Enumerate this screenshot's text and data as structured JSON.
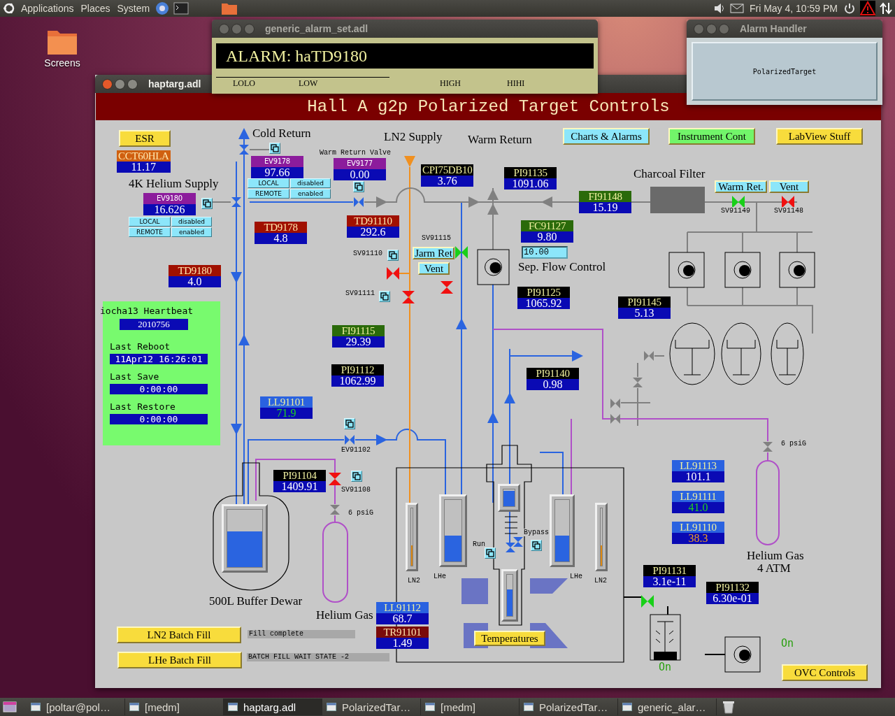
{
  "top_panel": {
    "menus": [
      "Applications",
      "Places",
      "System"
    ],
    "clock": "Fri May 4, 10:59 PM"
  },
  "desktop_icons": [
    {
      "label": "Screens"
    }
  ],
  "alarm_window": {
    "title": "generic_alarm_set.adl",
    "alarm": "ALARM: haTD9180",
    "limits": [
      "LOLO",
      "LOW",
      "HIGH",
      "HIHI"
    ]
  },
  "alarm_handler": {
    "title": "Alarm Handler",
    "groups": [
      "PolarizedTarget"
    ]
  },
  "main": {
    "title": "haptarg.adl",
    "header": "Hall A g2p Polarized Target Controls",
    "buttons": [
      {
        "label": "ESR",
        "color": "#f8dc3c"
      },
      {
        "label": "Charts & Alarms",
        "color": "#8ce6fa"
      },
      {
        "label": "Instrument Cont",
        "color": "#72f56a"
      },
      {
        "label": "LabView Stuff",
        "color": "#f8dc3c"
      },
      {
        "label": "Warm Ret.",
        "color": "#8ce6fa"
      },
      {
        "label": "Vent",
        "color": "#8ce6fa"
      },
      {
        "label": "Jarm Ret",
        "color": "#8ce6fa"
      },
      {
        "label": "Vent",
        "color": "#8ce6fa"
      },
      {
        "label": "Temperatures",
        "color": "#f8dc3c"
      },
      {
        "label": "LN2 Batch Fill",
        "color": "#f8dc3c"
      },
      {
        "label": "LHe Batch Fill",
        "color": "#f8dc3c"
      },
      {
        "label": "OVC Controls",
        "color": "#f8dc3c"
      }
    ],
    "mode_panels": [
      {
        "buttons": [
          "LOCAL",
          "disabled",
          "REMOTE",
          "enabled"
        ]
      },
      {
        "buttons": [
          "LOCAL",
          "disabled",
          "REMOTE",
          "enabled"
        ]
      }
    ],
    "readouts": [
      {
        "label": "CCT60HLA",
        "value": "11.17",
        "kind": "cct",
        "monitored": false,
        "alarm": false
      },
      {
        "label": "EV9178",
        "value": "97.66",
        "kind": "valve",
        "monitored": false,
        "alarm": false
      },
      {
        "label": "EV9177",
        "value": "0.00",
        "kind": "valve",
        "monitored": false,
        "alarm": false
      },
      {
        "label": "CPI75DB10",
        "value": "3.76",
        "kind": "pressure",
        "monitored": false,
        "alarm": false
      },
      {
        "label": "EV9180",
        "value": "16.626",
        "kind": "valve",
        "monitored": false,
        "alarm": false
      },
      {
        "label": "TD9178",
        "value": "4.8",
        "kind": "temperature",
        "monitored": false,
        "alarm": false
      },
      {
        "label": "TD91110",
        "value": "292.6",
        "kind": "temperature",
        "monitored": false,
        "alarm": false
      },
      {
        "label": "TD9180",
        "value": "4.0",
        "kind": "temperature",
        "monitored": false,
        "alarm": false
      },
      {
        "label": "PI91135",
        "value": "1091.06",
        "kind": "pressure",
        "monitored": false,
        "alarm": false
      },
      {
        "label": "FI91148",
        "value": "15.19",
        "kind": "flow",
        "monitored": false,
        "alarm": false
      },
      {
        "label": "FC91127",
        "value": "9.80",
        "kind": "flow",
        "monitored": false,
        "alarm": false
      },
      {
        "label": "PI91125",
        "value": "1065.92",
        "kind": "pressure",
        "monitored": false,
        "alarm": false
      },
      {
        "label": "PI91145",
        "value": "5.13",
        "kind": "pressure",
        "monitored": false,
        "alarm": false
      },
      {
        "label": "FI91115",
        "value": "29.39",
        "kind": "flow",
        "monitored": false,
        "alarm": false
      },
      {
        "label": "PI91112",
        "value": "1062.99",
        "kind": "pressure",
        "monitored": false,
        "alarm": false
      },
      {
        "label": "LL91101",
        "value": "71.9",
        "kind": "level",
        "monitored": true,
        "alarm": false
      },
      {
        "label": "PI91140",
        "value": "0.98",
        "kind": "pressure",
        "monitored": false,
        "alarm": false
      },
      {
        "label": "PI91104",
        "value": "1409.91",
        "kind": "pressure",
        "monitored": false,
        "alarm": false
      },
      {
        "label": "LL91113",
        "value": "101.1",
        "kind": "level",
        "monitored": false,
        "alarm": false
      },
      {
        "label": "LL91111",
        "value": "41.0",
        "kind": "level",
        "monitored": true,
        "alarm": false
      },
      {
        "label": "LL91110",
        "value": "38.3",
        "kind": "level",
        "monitored": true,
        "alarm": true
      },
      {
        "label": "LL91112",
        "value": "68.7",
        "kind": "level",
        "monitored": false,
        "alarm": false
      },
      {
        "label": "TR91101",
        "value": "1.49",
        "kind": "resistance",
        "monitored": false,
        "alarm": false
      },
      {
        "label": "PI91131",
        "value": "3.1e-11",
        "kind": "pressure",
        "monitored": false,
        "alarm": false
      },
      {
        "label": "PI91132",
        "value": "6.30e-01",
        "kind": "pressure",
        "monitored": false,
        "alarm": false
      }
    ],
    "labels": [
      {
        "text": "Cold Return",
        "kind": "title"
      },
      {
        "text": "LN2 Supply",
        "kind": "title"
      },
      {
        "text": "Warm Return",
        "kind": "title"
      },
      {
        "text": "4K Helium Supply",
        "kind": "title"
      },
      {
        "text": "Charcoal Filter",
        "kind": "title"
      },
      {
        "text": "Sep. Flow Control",
        "kind": "title"
      },
      {
        "text": "500L Buffer Dewar",
        "kind": "title"
      },
      {
        "text": "Helium Gas",
        "kind": "title"
      },
      {
        "text": "Helium Gas",
        "kind": "title"
      },
      {
        "text": "4 ATM",
        "kind": "title"
      },
      {
        "text": "Warm Return Valve",
        "kind": "small"
      },
      {
        "text": "SV91115",
        "kind": "small"
      },
      {
        "text": "SV91110",
        "kind": "small"
      },
      {
        "text": "SV91111",
        "kind": "small"
      },
      {
        "text": "SV91149",
        "kind": "small"
      },
      {
        "text": "SV91148",
        "kind": "small"
      },
      {
        "text": "EV91102",
        "kind": "small"
      },
      {
        "text": "SV91108",
        "kind": "small"
      },
      {
        "text": "6 psiG",
        "kind": "small"
      },
      {
        "text": "6 psiG",
        "kind": "small"
      },
      {
        "text": "Run",
        "kind": "small"
      },
      {
        "text": "Bypass",
        "kind": "small"
      },
      {
        "text": "LN2",
        "kind": "small"
      },
      {
        "text": "LHe",
        "kind": "small"
      },
      {
        "text": "LHe",
        "kind": "small"
      },
      {
        "text": "LN2",
        "kind": "small"
      },
      {
        "text": "On",
        "kind": "status"
      },
      {
        "text": "On",
        "kind": "status"
      }
    ],
    "valves": [
      {
        "open": true
      },
      {
        "open": false
      },
      {
        "open": false
      },
      {
        "open": false
      },
      {
        "open": true
      },
      {
        "open": false
      },
      {
        "open": false
      },
      {
        "open": true
      }
    ],
    "setpoint": {
      "value": "10.00"
    },
    "fill_status": [
      "Fill complete",
      "BATCH FILL WAIT STATE -2"
    ],
    "heartbeat": {
      "title": "iocha13 Heartbeat",
      "counter": "2010756",
      "rows": [
        {
          "label": "Last Reboot",
          "value": "11Apr12 16:26:01"
        },
        {
          "label": "Last Save",
          "value": "0:00:00"
        },
        {
          "label": "Last Restore",
          "value": "0:00:00"
        }
      ]
    },
    "gauges": [
      {
        "level": 0.62
      },
      {
        "level": 0.35
      },
      {
        "level": 0.42
      },
      {
        "level": 0.9
      },
      {
        "level": 0.65
      },
      {
        "level": 0.42
      },
      {
        "level": 0.35
      }
    ]
  },
  "taskbar": [
    {
      "label": "[poltar@pol…",
      "selected": false
    },
    {
      "label": "[medm]",
      "selected": false
    },
    {
      "label": "haptarg.adl",
      "selected": true
    },
    {
      "label": "PolarizedTar…",
      "selected": false
    },
    {
      "label": "[medm]",
      "selected": false
    },
    {
      "label": "PolarizedTar…",
      "selected": false
    },
    {
      "label": "generic_alar…",
      "selected": false
    }
  ]
}
